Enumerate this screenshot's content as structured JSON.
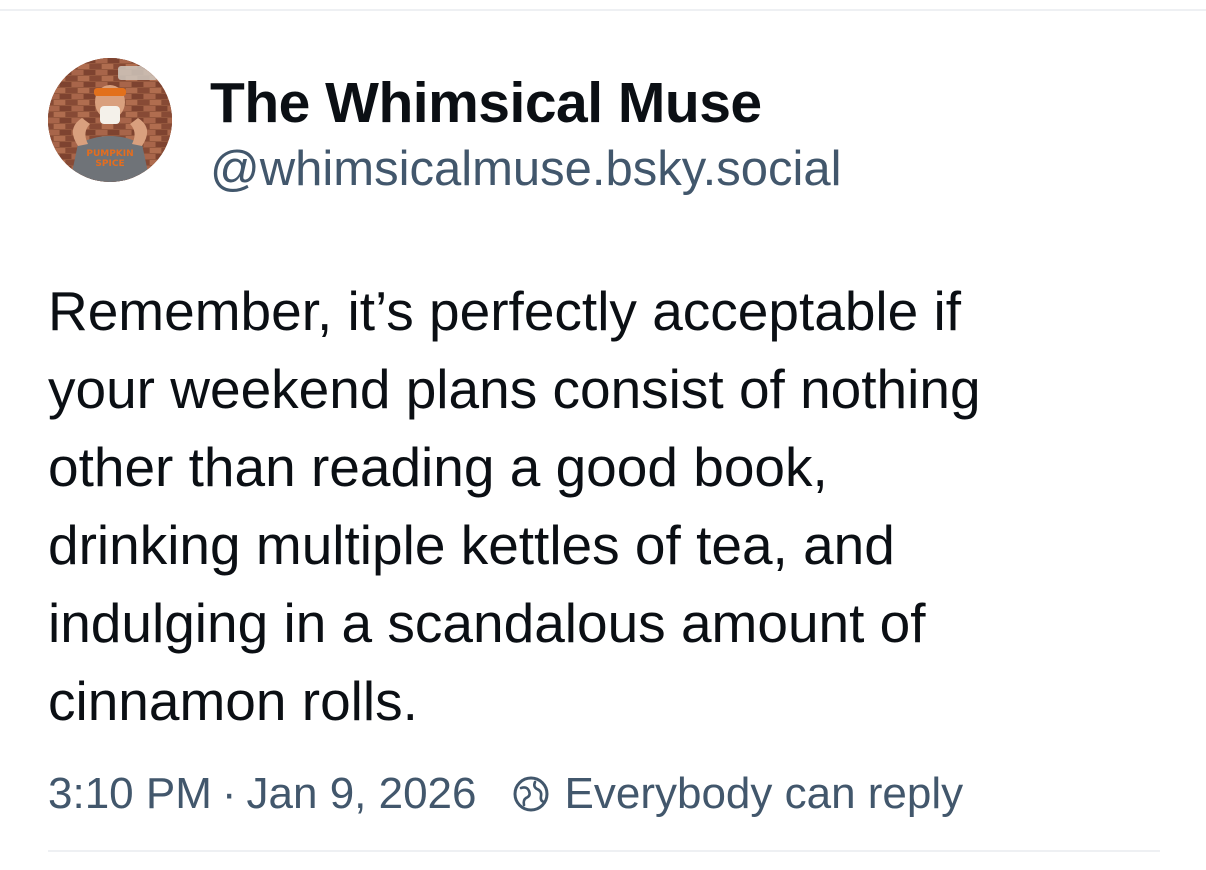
{
  "post": {
    "author": {
      "display_name": "The Whimsical Muse",
      "handle": "@whimsicalmuse.bsky.social",
      "avatar_shirt_text": "PUMPKIN SPICE"
    },
    "text": "Remember, it’s perfectly acceptable if\nyour weekend plans consist of nothing\nother than reading a good book,\ndrinking multiple kettles of tea, and\nindulging in a scandalous amount of\ncinnamon rolls.",
    "time": "3:10 PM",
    "separator": "·",
    "date": "Jan 9, 2026",
    "reply_setting": "Everybody can reply"
  },
  "icons": {
    "reply_setting_icon": "globe-icon"
  },
  "colors": {
    "text_primary": "#0b0f14",
    "text_secondary": "#42576c",
    "divider": "#eef0f3",
    "background": "#ffffff"
  }
}
